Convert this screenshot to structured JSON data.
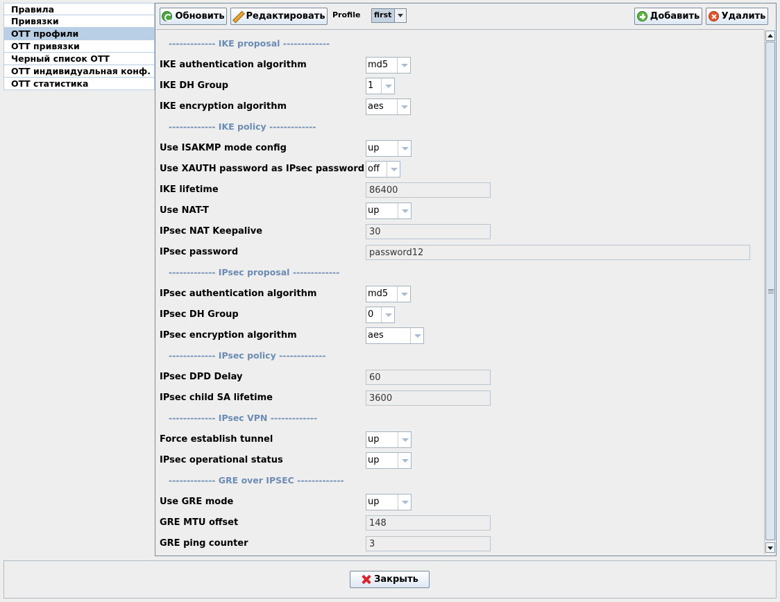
{
  "nav": {
    "items": [
      {
        "label": "Правила",
        "selected": false
      },
      {
        "label": "Привязки",
        "selected": false
      },
      {
        "label": "ОТТ профили",
        "selected": true
      },
      {
        "label": "ОТТ привязки",
        "selected": false
      },
      {
        "label": "Черный список ОТТ",
        "selected": false
      },
      {
        "label": "ОТТ индивидуальная конф.",
        "selected": false
      },
      {
        "label": "ОТТ статистика",
        "selected": false
      }
    ]
  },
  "toolbar": {
    "refresh_label": "Обновить",
    "edit_label": "Редактировать",
    "profile_label": "Profile",
    "profile_value": "first",
    "add_label": "Добавить",
    "delete_label": "Удалить"
  },
  "form": {
    "ike_proposal_header": "------------- IKE proposal -------------",
    "ike_auth_label": "IKE authentication algorithm",
    "ike_auth_value": "md5",
    "ike_dh_label": "IKE DH Group",
    "ike_dh_value": "1",
    "ike_enc_label": "IKE encryption algorithm",
    "ike_enc_value": "aes",
    "ike_policy_header": "------------- IKE policy -------------",
    "isakmp_label": "Use ISAKMP mode config",
    "isakmp_value": "up",
    "xauth_label": "Use XAUTH password as IPsec password",
    "xauth_value": "off",
    "ike_lifetime_label": "IKE lifetime",
    "ike_lifetime_value": "86400",
    "nat_t_label": "Use NAT-T",
    "nat_t_value": "up",
    "nat_keepalive_label": "IPsec NAT Keepalive",
    "nat_keepalive_value": "30",
    "ipsec_password_label": "IPsec password",
    "ipsec_password_value": "password12",
    "ipsec_proposal_header": "------------- IPsec proposal -------------",
    "ipsec_auth_label": "IPsec authentication algorithm",
    "ipsec_auth_value": "md5",
    "ipsec_dh_label": "IPsec DH Group",
    "ipsec_dh_value": "0",
    "ipsec_enc_label": "IPsec encryption algorithm",
    "ipsec_enc_value": "aes",
    "ipsec_policy_header": "------------- IPsec policy -------------",
    "dpd_delay_label": "IPsec DPD Delay",
    "dpd_delay_value": "60",
    "child_sa_label": "IPsec child SA lifetime",
    "child_sa_value": "3600",
    "ipsec_vpn_header": "------------- IPsec VPN -------------",
    "force_tunnel_label": "Force establish tunnel",
    "force_tunnel_value": "up",
    "op_status_label": "IPsec operational status",
    "op_status_value": "up",
    "gre_header": "------------- GRE over IPSEC -------------",
    "gre_mode_label": "Use GRE mode",
    "gre_mode_value": "up",
    "gre_mtu_label": "GRE MTU offset",
    "gre_mtu_value": "148",
    "gre_ping_label": "GRE ping counter",
    "gre_ping_value": "3"
  },
  "footer": {
    "close_label": "Закрыть"
  },
  "colors": {
    "selected_nav": "#b8cfe5",
    "section_header": "#6c8cb4",
    "background": "#eeeeee"
  },
  "icons": {
    "refresh": "refresh-icon",
    "edit": "pencil-icon",
    "add": "add-icon",
    "delete": "delete-icon",
    "close": "close-icon"
  }
}
